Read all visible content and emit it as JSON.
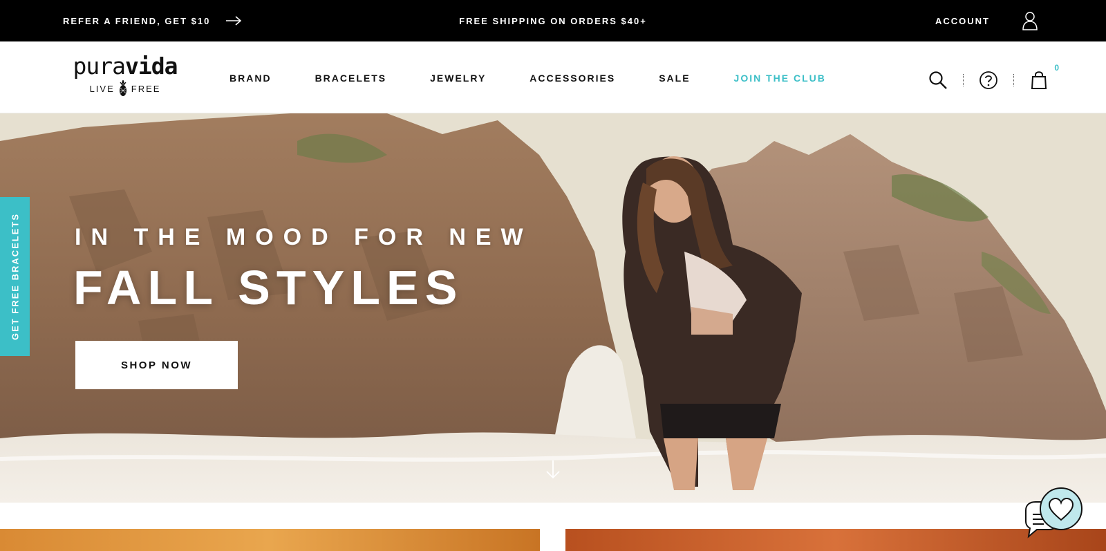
{
  "announcement": {
    "refer_label": "REFER A FRIEND, GET $10",
    "shipping_label": "FREE SHIPPING ON ORDERS $40+",
    "account_label": "ACCOUNT"
  },
  "brand": {
    "wordmark_light": "pura",
    "wordmark_bold": "vida",
    "tagline_left": "LIVE",
    "tagline_right": "FREE"
  },
  "nav": {
    "items": [
      {
        "label": "BRAND"
      },
      {
        "label": "BRACELETS"
      },
      {
        "label": "JEWELRY"
      },
      {
        "label": "ACCESSORIES"
      },
      {
        "label": "SALE"
      },
      {
        "label": "JOIN THE CLUB"
      }
    ]
  },
  "utility": {
    "cart_count": "0"
  },
  "hero": {
    "kicker": "IN THE MOOD FOR NEW",
    "headline": "FALL STYLES",
    "cta_label": "SHOP NOW"
  },
  "side_tab": {
    "label": "GET FREE BRACELETS"
  },
  "colors": {
    "accent": "#3cbfc7",
    "topbar": "#000000"
  }
}
